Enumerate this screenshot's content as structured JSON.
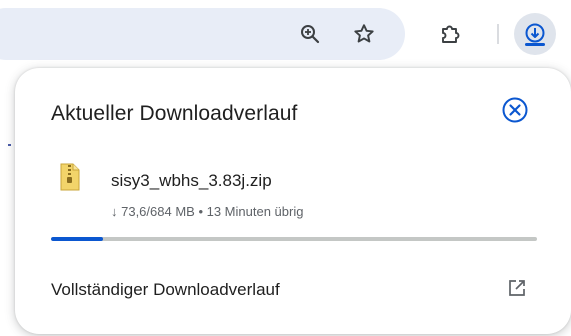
{
  "toolbar": {
    "icons": [
      "zoom-in-icon",
      "star-icon",
      "extensions-icon",
      "download-icon"
    ],
    "accent_color": "#0b57d0"
  },
  "download_panel": {
    "title": "Aktueller Downloadverlauf",
    "close_icon": "close-icon",
    "items": [
      {
        "file_name": "sisy3_wbhs_3.83j.zip",
        "status": "↓ 73,6/684 MB • 13 Minuten übrig",
        "progress": 0.108,
        "icon": "zip-file-icon"
      }
    ],
    "full_history_label": "Vollständiger Downloadverlauf",
    "open_icon": "open-in-new-icon"
  }
}
